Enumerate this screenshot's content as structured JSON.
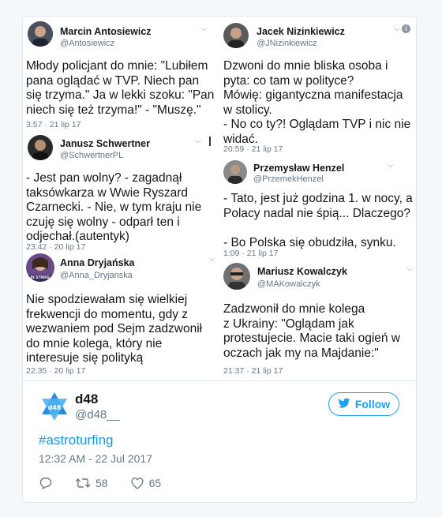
{
  "collage": {
    "tweets": [
      {
        "name": "Marcin Antosiewicz",
        "handle": "@Antosiewicz",
        "text": "Młody policjant do mnie: \"Lubiłem\npana oglądać w TVP. Niech pan\nsię trzyma.\" Ja w lekki szoku: \"Pan\nniech się też trzyma!\" - \"Muszę.\"",
        "time": "3:57 · 21 lip 17"
      },
      {
        "name": "Janusz Schwertner",
        "handle": "@SchwertnerPL",
        "text": "- Jest pan wolny? - zagadnął\ntaksówkarza w Wwie Ryszard\nCzarnecki. - Nie, w tym kraju nie\nczuję się wolny - odparł ten i\nodjechał.(autentyk)",
        "time": "23:42 · 20 lip 17"
      },
      {
        "name": "Anna Dryjańska",
        "handle": "@Anna_Dryjanska",
        "text": "Nie spodziewałam się wielkiej\nfrekwencji do momentu, gdy z\nwezwaniem pod Sejm zadzwonił\ndo mnie kolega, który nie\ninteresuje się polityką",
        "time": "22:35 · 20 lip 17",
        "avatar_label": "IN STRIKE"
      },
      {
        "name": "Jacek Nizinkiewicz",
        "handle": "@JNizinkiewicz",
        "text": "Dzwoni do mnie bliska osoba i\npyta: co tam w polityce?\nMówię: gigantyczna manifestacja\nw stolicy.\n- No co ty?! Oglądam TVP i nic nie\nwidać.",
        "time": "20:59 · 21 lip 17"
      },
      {
        "name": "Przemysław Henzel",
        "handle": "@PrzemekHenzel",
        "text": "- Tato, jest już godzina 1. w nocy, a\nPolacy nadal nie śpią... Dlaczego?\n\n- Bo Polska się obudziła, synku.",
        "time": "1:09 · 21 lip 17"
      },
      {
        "name": "Mariusz Kowalczyk",
        "handle": "@MAKowalczyk",
        "text": "Zadzwonił do mnie kolega\nz Ukrainy: \"Oglądam jak\nprotestujecie. Macie taki ogień w\noczach jak my na Majdanie:\"",
        "time": "21:37 · 21 lip 17"
      }
    ]
  },
  "tweet": {
    "author_name": "d48",
    "author_handle": "@d48__",
    "follow_label": "Follow",
    "hashtag": "#astroturfing",
    "timestamp": "12:32 AM - 22 Jul 2017",
    "retweets": "58",
    "likes": "65"
  },
  "colors": {
    "accent": "#1da1f2",
    "link": "#1b95e0",
    "secondary_text": "#657786",
    "border": "#e1e8ed"
  },
  "icons": {
    "chevron": "chevron-down-icon",
    "reply": "reply-icon",
    "retweet": "retweet-icon",
    "like": "heart-icon",
    "bird": "twitter-bird-icon",
    "info": "info-icon"
  }
}
